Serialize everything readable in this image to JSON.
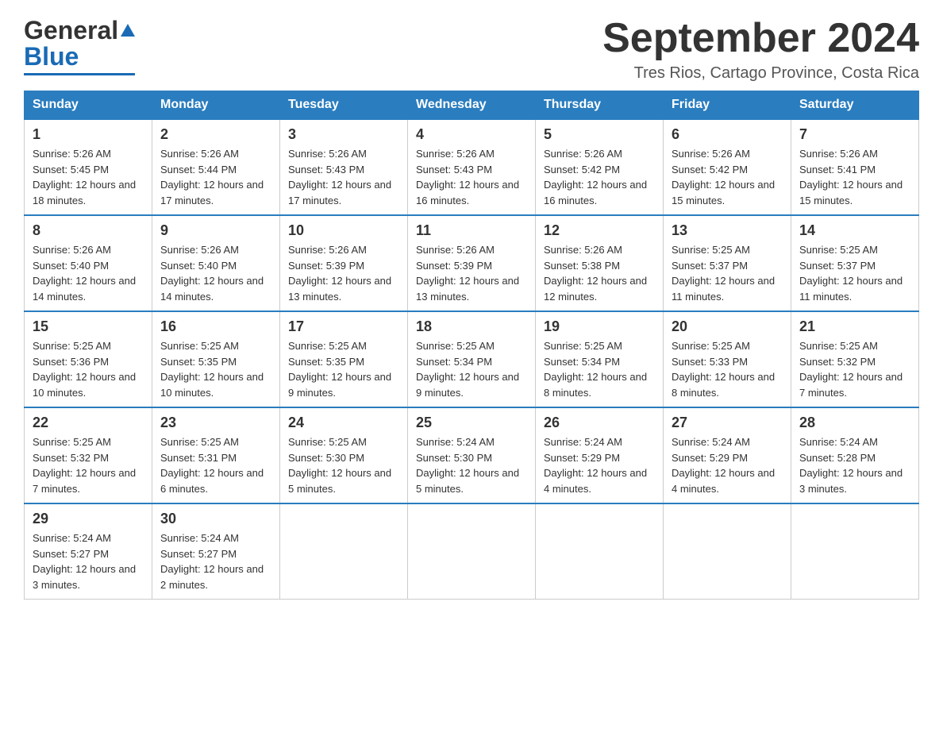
{
  "header": {
    "logo_general": "General",
    "logo_blue": "Blue",
    "month_title": "September 2024",
    "location": "Tres Rios, Cartago Province, Costa Rica"
  },
  "days_of_week": [
    "Sunday",
    "Monday",
    "Tuesday",
    "Wednesday",
    "Thursday",
    "Friday",
    "Saturday"
  ],
  "weeks": [
    [
      {
        "day": "1",
        "sunrise": "Sunrise: 5:26 AM",
        "sunset": "Sunset: 5:45 PM",
        "daylight": "Daylight: 12 hours and 18 minutes."
      },
      {
        "day": "2",
        "sunrise": "Sunrise: 5:26 AM",
        "sunset": "Sunset: 5:44 PM",
        "daylight": "Daylight: 12 hours and 17 minutes."
      },
      {
        "day": "3",
        "sunrise": "Sunrise: 5:26 AM",
        "sunset": "Sunset: 5:43 PM",
        "daylight": "Daylight: 12 hours and 17 minutes."
      },
      {
        "day": "4",
        "sunrise": "Sunrise: 5:26 AM",
        "sunset": "Sunset: 5:43 PM",
        "daylight": "Daylight: 12 hours and 16 minutes."
      },
      {
        "day": "5",
        "sunrise": "Sunrise: 5:26 AM",
        "sunset": "Sunset: 5:42 PM",
        "daylight": "Daylight: 12 hours and 16 minutes."
      },
      {
        "day": "6",
        "sunrise": "Sunrise: 5:26 AM",
        "sunset": "Sunset: 5:42 PM",
        "daylight": "Daylight: 12 hours and 15 minutes."
      },
      {
        "day": "7",
        "sunrise": "Sunrise: 5:26 AM",
        "sunset": "Sunset: 5:41 PM",
        "daylight": "Daylight: 12 hours and 15 minutes."
      }
    ],
    [
      {
        "day": "8",
        "sunrise": "Sunrise: 5:26 AM",
        "sunset": "Sunset: 5:40 PM",
        "daylight": "Daylight: 12 hours and 14 minutes."
      },
      {
        "day": "9",
        "sunrise": "Sunrise: 5:26 AM",
        "sunset": "Sunset: 5:40 PM",
        "daylight": "Daylight: 12 hours and 14 minutes."
      },
      {
        "day": "10",
        "sunrise": "Sunrise: 5:26 AM",
        "sunset": "Sunset: 5:39 PM",
        "daylight": "Daylight: 12 hours and 13 minutes."
      },
      {
        "day": "11",
        "sunrise": "Sunrise: 5:26 AM",
        "sunset": "Sunset: 5:39 PM",
        "daylight": "Daylight: 12 hours and 13 minutes."
      },
      {
        "day": "12",
        "sunrise": "Sunrise: 5:26 AM",
        "sunset": "Sunset: 5:38 PM",
        "daylight": "Daylight: 12 hours and 12 minutes."
      },
      {
        "day": "13",
        "sunrise": "Sunrise: 5:25 AM",
        "sunset": "Sunset: 5:37 PM",
        "daylight": "Daylight: 12 hours and 11 minutes."
      },
      {
        "day": "14",
        "sunrise": "Sunrise: 5:25 AM",
        "sunset": "Sunset: 5:37 PM",
        "daylight": "Daylight: 12 hours and 11 minutes."
      }
    ],
    [
      {
        "day": "15",
        "sunrise": "Sunrise: 5:25 AM",
        "sunset": "Sunset: 5:36 PM",
        "daylight": "Daylight: 12 hours and 10 minutes."
      },
      {
        "day": "16",
        "sunrise": "Sunrise: 5:25 AM",
        "sunset": "Sunset: 5:35 PM",
        "daylight": "Daylight: 12 hours and 10 minutes."
      },
      {
        "day": "17",
        "sunrise": "Sunrise: 5:25 AM",
        "sunset": "Sunset: 5:35 PM",
        "daylight": "Daylight: 12 hours and 9 minutes."
      },
      {
        "day": "18",
        "sunrise": "Sunrise: 5:25 AM",
        "sunset": "Sunset: 5:34 PM",
        "daylight": "Daylight: 12 hours and 9 minutes."
      },
      {
        "day": "19",
        "sunrise": "Sunrise: 5:25 AM",
        "sunset": "Sunset: 5:34 PM",
        "daylight": "Daylight: 12 hours and 8 minutes."
      },
      {
        "day": "20",
        "sunrise": "Sunrise: 5:25 AM",
        "sunset": "Sunset: 5:33 PM",
        "daylight": "Daylight: 12 hours and 8 minutes."
      },
      {
        "day": "21",
        "sunrise": "Sunrise: 5:25 AM",
        "sunset": "Sunset: 5:32 PM",
        "daylight": "Daylight: 12 hours and 7 minutes."
      }
    ],
    [
      {
        "day": "22",
        "sunrise": "Sunrise: 5:25 AM",
        "sunset": "Sunset: 5:32 PM",
        "daylight": "Daylight: 12 hours and 7 minutes."
      },
      {
        "day": "23",
        "sunrise": "Sunrise: 5:25 AM",
        "sunset": "Sunset: 5:31 PM",
        "daylight": "Daylight: 12 hours and 6 minutes."
      },
      {
        "day": "24",
        "sunrise": "Sunrise: 5:25 AM",
        "sunset": "Sunset: 5:30 PM",
        "daylight": "Daylight: 12 hours and 5 minutes."
      },
      {
        "day": "25",
        "sunrise": "Sunrise: 5:24 AM",
        "sunset": "Sunset: 5:30 PM",
        "daylight": "Daylight: 12 hours and 5 minutes."
      },
      {
        "day": "26",
        "sunrise": "Sunrise: 5:24 AM",
        "sunset": "Sunset: 5:29 PM",
        "daylight": "Daylight: 12 hours and 4 minutes."
      },
      {
        "day": "27",
        "sunrise": "Sunrise: 5:24 AM",
        "sunset": "Sunset: 5:29 PM",
        "daylight": "Daylight: 12 hours and 4 minutes."
      },
      {
        "day": "28",
        "sunrise": "Sunrise: 5:24 AM",
        "sunset": "Sunset: 5:28 PM",
        "daylight": "Daylight: 12 hours and 3 minutes."
      }
    ],
    [
      {
        "day": "29",
        "sunrise": "Sunrise: 5:24 AM",
        "sunset": "Sunset: 5:27 PM",
        "daylight": "Daylight: 12 hours and 3 minutes."
      },
      {
        "day": "30",
        "sunrise": "Sunrise: 5:24 AM",
        "sunset": "Sunset: 5:27 PM",
        "daylight": "Daylight: 12 hours and 2 minutes."
      },
      null,
      null,
      null,
      null,
      null
    ]
  ]
}
